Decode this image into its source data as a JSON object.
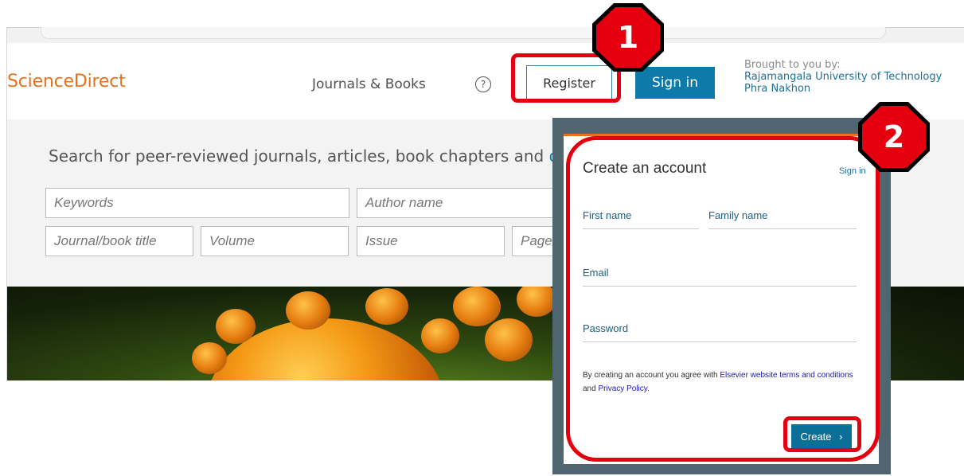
{
  "header": {
    "logo": "ScienceDirect",
    "nav_journals": "Journals & Books",
    "help_icon": "?",
    "register_label": "Register",
    "signin_label": "Sign in",
    "brought_label": "Brought to you by:",
    "institution_line1": "Rajamangala University of Technology",
    "institution_line2": "Phra Nakhon"
  },
  "search": {
    "headline": "Search for peer-reviewed journals, articles, book chapters and ",
    "headline_link": "op",
    "keywords_placeholder": "Keywords",
    "author_placeholder": "Author name",
    "journal_placeholder": "Journal/book title",
    "volume_placeholder": "Volume",
    "issue_placeholder": "Issue",
    "pages_placeholder": "Page"
  },
  "modal": {
    "title": "Create an account",
    "signin_link": "Sign in",
    "first_name_label": "First name",
    "family_name_label": "Family name",
    "email_label": "Email",
    "password_label": "Password",
    "terms_prefix": "By creating an account you agree with ",
    "terms_link": "Elsevier website terms and conditions",
    "terms_mid": " and ",
    "privacy_link": "Privacy Policy",
    "terms_suffix": ".",
    "create_label": "Create",
    "create_chevron": "›"
  },
  "annotations": {
    "step1": "1",
    "step2": "2",
    "highlight_color": "#e4000f"
  },
  "colors": {
    "brand_orange": "#e9711c",
    "primary_blue": "#0c7bab",
    "modal_frame": "#4f6570"
  }
}
